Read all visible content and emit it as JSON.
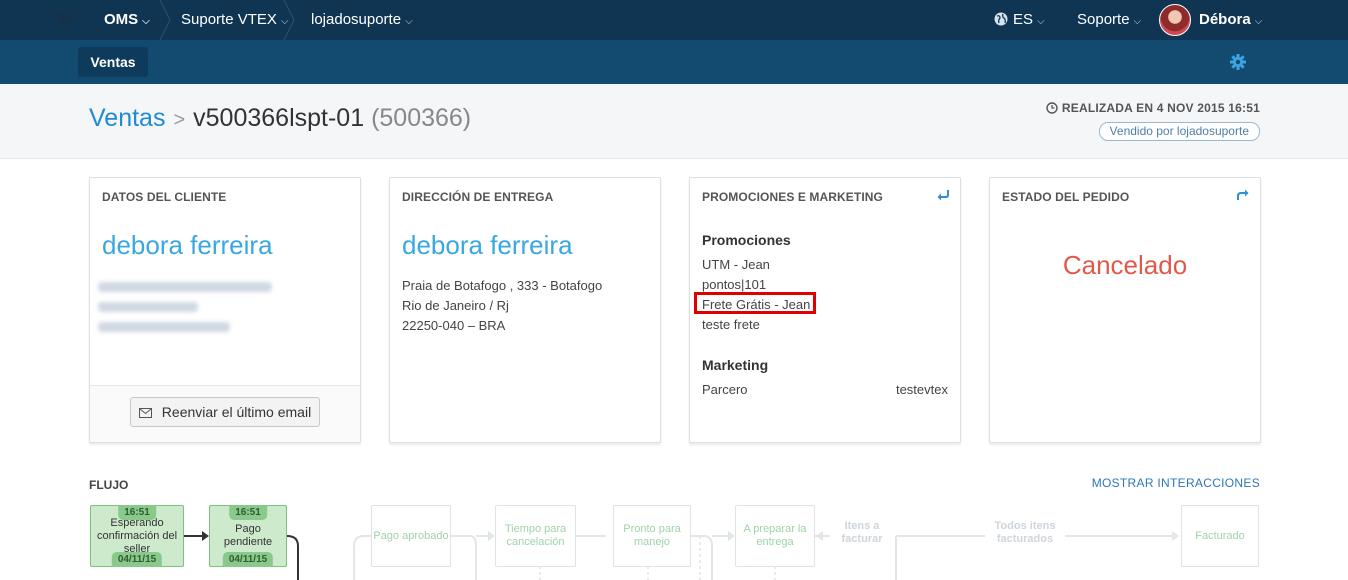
{
  "topbar": {
    "oms": "OMS",
    "account": "Suporte VTEX",
    "store": "lojadosuporte",
    "language": "ES",
    "support": "Soporte",
    "user": "Débora"
  },
  "subnav": {
    "tab": "Ventas"
  },
  "header": {
    "breadcrumb_root": "Ventas",
    "order_id": "v500366lspt-01",
    "order_seq": "(500366)",
    "realizada": "REALIZADA EN 4 NOV 2015 16:51",
    "vendido": "Vendido por lojadosuporte"
  },
  "cliente": {
    "title": "DATOS DEL CLIENTE",
    "name": "debora ferreira",
    "resend": "Reenviar el último email"
  },
  "entrega": {
    "title": "DIRECCIÓN DE ENTREGA",
    "name": "debora ferreira",
    "line1": "Praia de Botafogo , 333  - Botafogo",
    "line2": "Rio de Janeiro / Rj",
    "line3": "22250-040 – BRA"
  },
  "promociones": {
    "title": "PROMOCIONES E MARKETING",
    "promo_heading": "Promociones",
    "promos": [
      "UTM - Jean",
      "pontos|101",
      "Frete Grátis - Jean",
      "teste frete"
    ],
    "marketing_heading": "Marketing",
    "marketing_key": "Parcero",
    "marketing_value": "testevtex"
  },
  "estado": {
    "title": "ESTADO DEL PEDIDO",
    "status": "Cancelado"
  },
  "flujo": {
    "title": "FLUJO",
    "show_interactions": "MOSTRAR INTERACCIONES",
    "steps": [
      {
        "label": "Esperando confirmación del seller",
        "time": "16:51",
        "date": "04/11/15"
      },
      {
        "label": "Pago pendiente",
        "time": "16:51",
        "date": "04/11/15"
      },
      {
        "label": "Pago aprobado"
      },
      {
        "label": "Tiempo para cancelación"
      },
      {
        "label": "Pronto para manejo"
      },
      {
        "label": "A preparar la entrega"
      },
      {
        "label": "Itens a facturar"
      },
      {
        "label": "Todos itens facturados"
      },
      {
        "label": "Facturado"
      }
    ]
  },
  "colors": {
    "topbar": "#0f3553",
    "subbar": "#134a70",
    "link": "#1e8bd3",
    "name": "#39a8e0",
    "cancelled": "#e05a4c",
    "highlight": "#e00000",
    "flow_done": "#cdeacc"
  }
}
